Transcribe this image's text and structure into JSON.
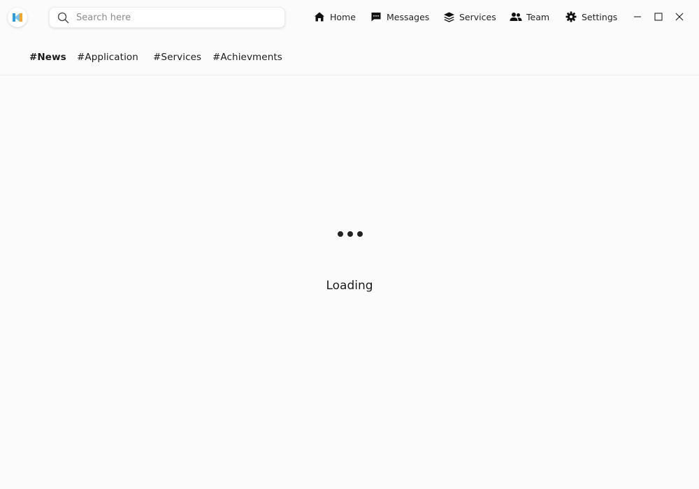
{
  "app": {
    "logo_icon": "app-logo-icon",
    "colors": {
      "background": "#fbfbfb",
      "logo_blue": "#2d9cdb",
      "logo_orange": "#f5a623",
      "text": "#1a1a1a",
      "divider": "#ececec"
    }
  },
  "search": {
    "placeholder": "Search here",
    "value": "",
    "icon": "search-icon"
  },
  "nav": {
    "items": [
      {
        "label": "Home",
        "icon": "home-icon"
      },
      {
        "label": "Messages",
        "icon": "message-icon"
      },
      {
        "label": "Services",
        "icon": "layers-icon"
      },
      {
        "label": "Team",
        "icon": "team-icon"
      },
      {
        "label": "Settings",
        "icon": "gear-icon"
      }
    ]
  },
  "window_controls": {
    "minimize_icon": "minimize-icon",
    "maximize_icon": "maximize-icon",
    "close_icon": "close-icon"
  },
  "tags": {
    "active": "#News",
    "items": [
      "#News",
      "#Application",
      "#Services",
      "#Achievments"
    ]
  },
  "main": {
    "loading_text": "Loading",
    "loader_icon": "loading-dots-icon"
  }
}
